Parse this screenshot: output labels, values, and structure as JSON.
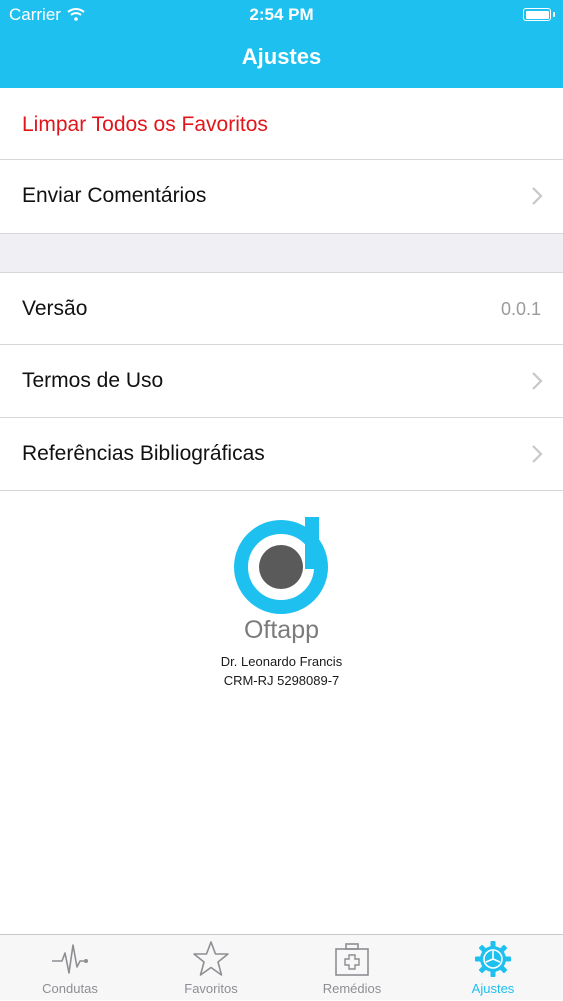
{
  "status_bar": {
    "carrier": "Carrier",
    "time": "2:54 PM"
  },
  "nav": {
    "title": "Ajustes"
  },
  "settings": {
    "clear_favorites": "Limpar Todos os Favoritos",
    "send_feedback": "Enviar Comentários",
    "version_label": "Versão",
    "version_value": "0.0.1",
    "terms": "Termos de Uso",
    "references": "Referências Bibliográficas"
  },
  "about": {
    "brand": "Oftapp",
    "author": "Dr. Leonardo Francis",
    "registration": "CRM-RJ 5298089-7"
  },
  "tabs": [
    {
      "label": "Condutas",
      "icon": "pulse-icon"
    },
    {
      "label": "Favoritos",
      "icon": "star-icon"
    },
    {
      "label": "Remédios",
      "icon": "first-aid-kit-icon"
    },
    {
      "label": "Ajustes",
      "icon": "gear-icon",
      "active": true
    }
  ],
  "colors": {
    "accent": "#1ec0ef",
    "destructive": "#e1161b",
    "logo_dark": "#5a5a5a"
  }
}
